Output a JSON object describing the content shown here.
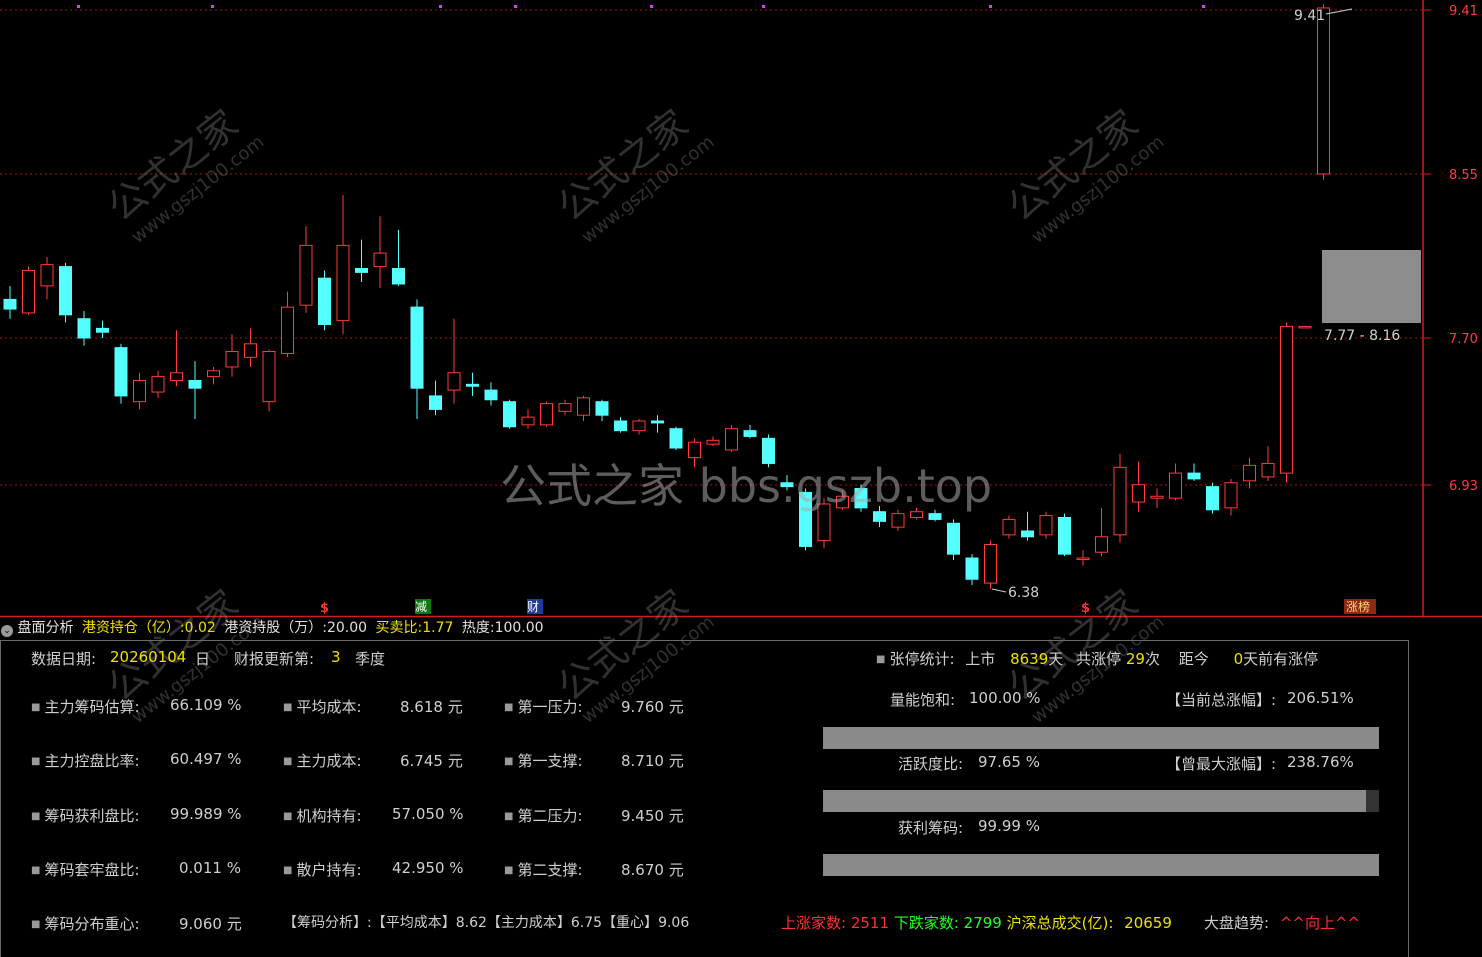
{
  "price_axis": {
    "labels": [
      "9.41",
      "8.55",
      "7.70",
      "6.93"
    ]
  },
  "chart_annotations": {
    "high_label": "9.41",
    "low_label": "6.38",
    "range_box_label": "7.77 - 8.16"
  },
  "event_markers": [
    "$",
    "减",
    "财",
    "$",
    "涨榜"
  ],
  "candles": [
    [
      7.9,
      7.85,
      7.97,
      7.8
    ],
    [
      7.83,
      8.05,
      8.07,
      7.82
    ],
    [
      7.97,
      8.08,
      8.12,
      7.9
    ],
    [
      8.07,
      7.82,
      8.09,
      7.78
    ],
    [
      7.8,
      7.7,
      7.84,
      7.66
    ],
    [
      7.75,
      7.73,
      7.79,
      7.7
    ],
    [
      7.65,
      7.4,
      7.67,
      7.36
    ],
    [
      7.37,
      7.48,
      7.52,
      7.33
    ],
    [
      7.42,
      7.5,
      7.53,
      7.39
    ],
    [
      7.48,
      7.52,
      7.74,
      7.45
    ],
    [
      7.48,
      7.44,
      7.58,
      7.28
    ],
    [
      7.5,
      7.53,
      7.55,
      7.46
    ],
    [
      7.55,
      7.63,
      7.72,
      7.5
    ],
    [
      7.6,
      7.67,
      7.75,
      7.55
    ],
    [
      7.37,
      7.63,
      7.64,
      7.32
    ],
    [
      7.62,
      7.86,
      7.94,
      7.6
    ],
    [
      7.87,
      8.18,
      8.28,
      7.83
    ],
    [
      8.01,
      7.77,
      8.05,
      7.74
    ],
    [
      7.79,
      8.18,
      8.44,
      7.72
    ],
    [
      8.06,
      8.04,
      8.21,
      7.99
    ],
    [
      8.07,
      8.14,
      8.33,
      7.96
    ],
    [
      8.06,
      7.98,
      8.26,
      7.97
    ],
    [
      7.86,
      7.44,
      7.9,
      7.28
    ],
    [
      7.4,
      7.33,
      7.48,
      7.3
    ],
    [
      7.43,
      7.52,
      7.8,
      7.36
    ],
    [
      7.46,
      7.45,
      7.52,
      7.4
    ],
    [
      7.43,
      7.38,
      7.47,
      7.35
    ],
    [
      7.37,
      7.24,
      7.38,
      7.23
    ],
    [
      7.25,
      7.29,
      7.33,
      7.23
    ],
    [
      7.25,
      7.36,
      7.37,
      7.24
    ],
    [
      7.32,
      7.36,
      7.38,
      7.3
    ],
    [
      7.3,
      7.39,
      7.4,
      7.27
    ],
    [
      7.37,
      7.3,
      7.38,
      7.27
    ],
    [
      7.27,
      7.22,
      7.29,
      7.21
    ],
    [
      7.22,
      7.27,
      7.28,
      7.2
    ],
    [
      7.27,
      7.26,
      7.3,
      7.21
    ],
    [
      7.23,
      7.13,
      7.24,
      7.12
    ],
    [
      7.08,
      7.16,
      7.18,
      7.03
    ],
    [
      7.15,
      7.17,
      7.19,
      7.14
    ],
    [
      7.12,
      7.23,
      7.25,
      7.11
    ],
    [
      7.22,
      7.19,
      7.25,
      7.18
    ],
    [
      7.18,
      7.05,
      7.2,
      7.03
    ],
    [
      6.95,
      6.93,
      6.99,
      6.91
    ],
    [
      6.9,
      6.62,
      6.92,
      6.6
    ],
    [
      6.65,
      6.84,
      6.87,
      6.61
    ],
    [
      6.82,
      6.88,
      6.91,
      6.81
    ],
    [
      6.92,
      6.82,
      6.94,
      6.8
    ],
    [
      6.8,
      6.75,
      6.83,
      6.72
    ],
    [
      6.72,
      6.79,
      6.81,
      6.7
    ],
    [
      6.77,
      6.8,
      6.82,
      6.76
    ],
    [
      6.79,
      6.76,
      6.81,
      6.75
    ],
    [
      6.74,
      6.58,
      6.76,
      6.55
    ],
    [
      6.56,
      6.45,
      6.58,
      6.42
    ],
    [
      6.43,
      6.63,
      6.65,
      6.4
    ],
    [
      6.68,
      6.76,
      6.78,
      6.66
    ],
    [
      6.7,
      6.67,
      6.8,
      6.65
    ],
    [
      6.68,
      6.78,
      6.8,
      6.66
    ],
    [
      6.77,
      6.58,
      6.79,
      6.57
    ],
    [
      6.56,
      6.56,
      6.6,
      6.52
    ],
    [
      6.59,
      6.67,
      6.82,
      6.57
    ],
    [
      6.68,
      7.03,
      7.1,
      6.64
    ],
    [
      6.85,
      6.94,
      7.06,
      6.8
    ],
    [
      6.87,
      6.88,
      6.92,
      6.82
    ],
    [
      6.87,
      7.0,
      7.05,
      6.86
    ],
    [
      7.0,
      6.97,
      7.05,
      6.96
    ],
    [
      6.93,
      6.81,
      6.95,
      6.79
    ],
    [
      6.82,
      6.95,
      6.97,
      6.78
    ],
    [
      6.96,
      7.04,
      7.08,
      6.92
    ],
    [
      6.98,
      7.05,
      7.14,
      6.96
    ],
    [
      7.0,
      7.76,
      7.78,
      6.95
    ],
    [
      7.76,
      7.76,
      7.76,
      7.76
    ],
    [
      8.55,
      9.41,
      9.43,
      8.52
    ]
  ],
  "header": {
    "indicator_name": "盘面分析",
    "items": [
      {
        "label": "港资持仓（亿）:",
        "value": "0.02"
      },
      {
        "label": "港资持股（万）:",
        "value": "20.00"
      },
      {
        "label": "买卖比:",
        "value": "1.77"
      },
      {
        "label": "热度:",
        "value": "100.00"
      }
    ]
  },
  "info": {
    "data_date_label": "数据日期:",
    "data_date_value": "20260104",
    "data_date_unit": "日",
    "report_label": "财报更新第:",
    "report_value": "3",
    "report_unit": "季度"
  },
  "grid": {
    "col1": [
      {
        "label": "主力筹码估算:",
        "value": "66.109 %"
      },
      {
        "label": "主力控盘比率:",
        "value": "60.497 %"
      },
      {
        "label": "筹码获利盘比:",
        "value": "99.989 %"
      },
      {
        "label": "筹码套牢盘比:",
        "value": "0.011 %"
      },
      {
        "label": "筹码分布重心:",
        "value": "9.060 元"
      }
    ],
    "col2": [
      {
        "label": "平均成本:",
        "value": "8.618 元"
      },
      {
        "label": "主力成本:",
        "value": "6.745 元"
      },
      {
        "label": "机构持有:",
        "value": "57.050 %"
      },
      {
        "label": "散户持有:",
        "value": "42.950 %"
      }
    ],
    "col3": [
      {
        "label": "第一压力:",
        "value": "9.760 元"
      },
      {
        "label": "第一支撑:",
        "value": "8.710 元"
      },
      {
        "label": "第二压力:",
        "value": "9.450 元"
      },
      {
        "label": "第二支撑:",
        "value": "8.670 元"
      }
    ],
    "chip_summary": {
      "title": "【筹码分析】:",
      "avg_label": "【平均成本】",
      "avg_value": "8.62",
      "main_label": "【主力成本】",
      "main_value": "6.75",
      "center_label": "【重心】",
      "center_value": "9.06"
    }
  },
  "limit_stats": {
    "label": "张停统计:",
    "listed_label": "上市",
    "listed_value": "8639",
    "listed_unit": "天",
    "total_label": "共涨停",
    "total_value": "29",
    "total_unit": "次",
    "since_label": "距今",
    "since_value": "0",
    "since_unit": "天前有涨停"
  },
  "energy": {
    "label": "量能饱和:",
    "value": "100.00 %",
    "fraction": 1.0
  },
  "activity": {
    "label": "活跃度比:",
    "value": "97.65 %",
    "fraction": 0.9765
  },
  "profit": {
    "label": "获利筹码:",
    "value": "99.99 %",
    "fraction": 0.9999
  },
  "total_gain": {
    "label": "【当前总涨幅】:",
    "value": "206.51%"
  },
  "max_gain": {
    "label": "【曾最大涨幅】:",
    "value": "238.76%"
  },
  "market": {
    "up_label": "上涨家数:",
    "up_value": "2511",
    "down_label": "下跌家数:",
    "down_value": "2799",
    "turnover_label": "沪深总成交(亿):",
    "turnover_value": "20659",
    "trend_label": "大盘趋势:",
    "trend_value": "^^向上^^"
  },
  "watermarks": {
    "center": "公式之家 bbs.gszb.top",
    "diagonal_main": "公式之家",
    "diagonal_sub": "www.gszj100.com"
  },
  "colors": {
    "up": "#ff3b3b",
    "down": "#54ffff",
    "grid_red": "#cc1f1f",
    "value_yellow": "#f0e000"
  }
}
